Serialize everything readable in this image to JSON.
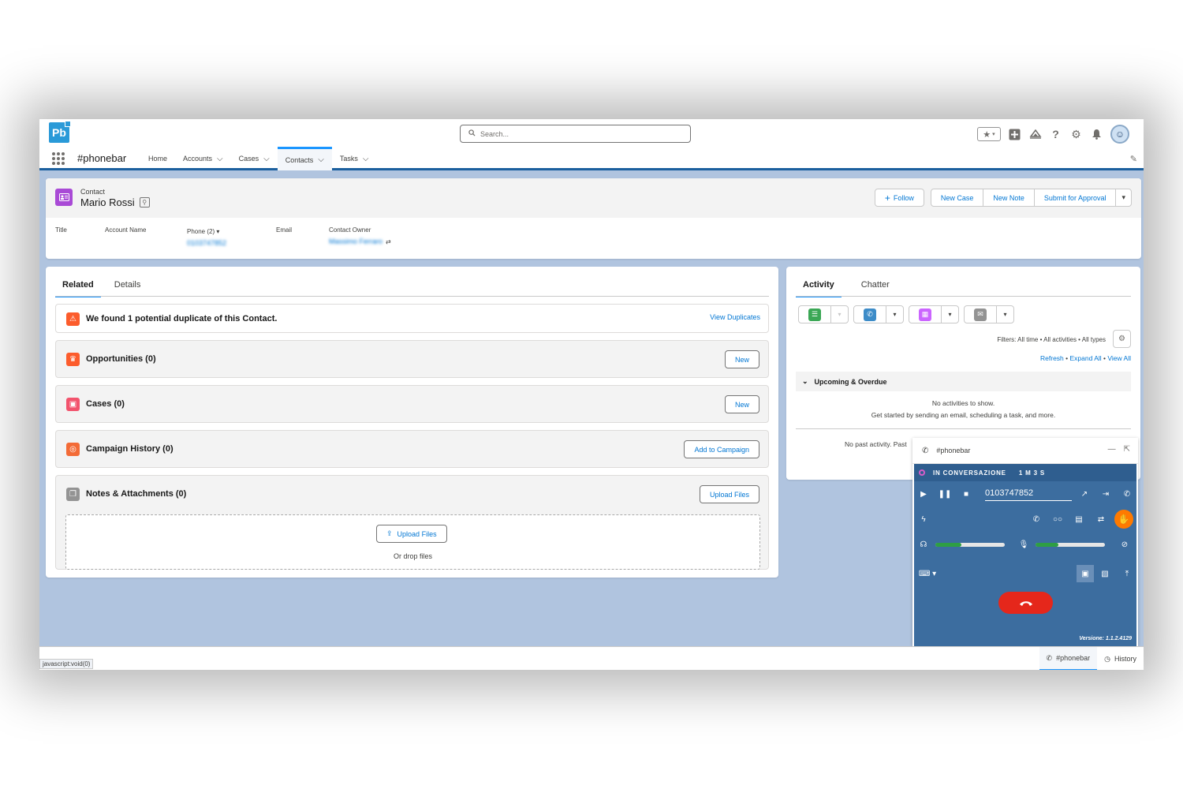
{
  "header": {
    "logo": "Pb",
    "search_placeholder": "Search..."
  },
  "nav": {
    "app_name": "#phonebar",
    "items": [
      {
        "label": "Home",
        "has_menu": false
      },
      {
        "label": "Accounts",
        "has_menu": true
      },
      {
        "label": "Cases",
        "has_menu": true
      },
      {
        "label": "Contacts",
        "has_menu": true,
        "active": true
      },
      {
        "label": "Tasks",
        "has_menu": true
      }
    ]
  },
  "record": {
    "object_label": "Contact",
    "name": "Mario Rossi",
    "actions": {
      "follow": "Follow",
      "new_case": "New Case",
      "new_note": "New Note",
      "submit": "Submit for Approval"
    },
    "fields": {
      "title_label": "Title",
      "account_label": "Account Name",
      "phone_label": "Phone (2)",
      "phone_value": "0103747852",
      "email_label": "Email",
      "owner_label": "Contact Owner",
      "owner_value": "Massimo Ferraro"
    }
  },
  "related": {
    "tabs": [
      "Related",
      "Details"
    ],
    "duplicate_text": "We found 1 potential duplicate of this Contact.",
    "duplicate_link": "View Duplicates",
    "lists": [
      {
        "title": "Opportunities (0)",
        "button": "New",
        "color": "#fc5c2c"
      },
      {
        "title": "Cases (0)",
        "button": "New",
        "color": "#f2536d"
      },
      {
        "title": "Campaign History (0)",
        "button": "Add to Campaign",
        "color": "#f36b37"
      },
      {
        "title": "Notes & Attachments (0)",
        "button": "Upload Files",
        "color": "#939393"
      }
    ],
    "upload_button": "Upload Files",
    "drop_text": "Or drop files"
  },
  "activity": {
    "tabs": [
      "Activity",
      "Chatter"
    ],
    "filters": "Filters: All time • All activities • All types",
    "links": [
      "Refresh",
      "Expand All",
      "View All"
    ],
    "upcoming": "Upcoming & Overdue",
    "no_activities": "No activities to show.",
    "get_started": "Get started by sending an email, scheduling a task, and more.",
    "no_past": "No past activity. Past"
  },
  "phonebar": {
    "title": "#phonebar",
    "status": "IN CONVERSAZIONE",
    "timer": "1 M 3 S",
    "number": "0103747852",
    "speaker_level": 0.38,
    "mic_level": 0.33,
    "version": "Versione: 1.1.2.4129"
  },
  "utility": {
    "status_url": "javascript:void(0)",
    "phonebar": "#phonebar",
    "history": "History"
  },
  "colors": {
    "brand": "#2a9ad8",
    "nav_accent": "#1b96ff",
    "phonebar_bg": "#3c6d9f",
    "hangup": "#e5271b"
  }
}
